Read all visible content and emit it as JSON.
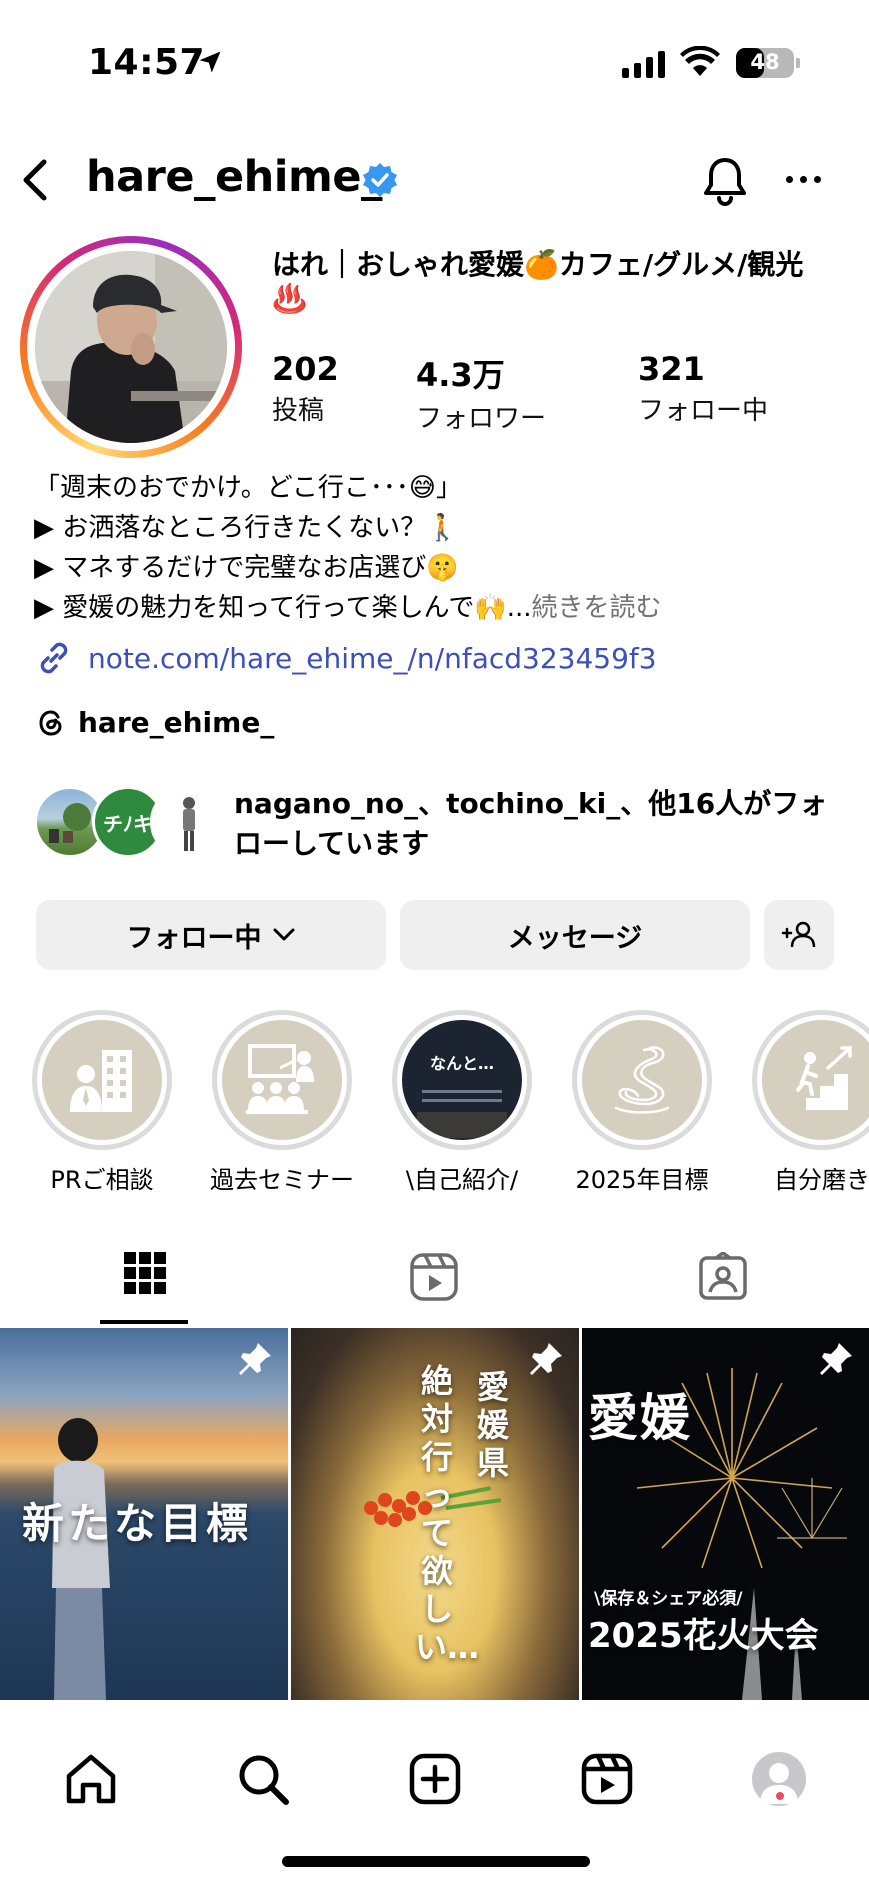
{
  "status_bar": {
    "time": "14:57",
    "battery": "48",
    "battery_level": 0.48
  },
  "header": {
    "username": "hare_ehime_"
  },
  "profile": {
    "display_name": "はれ｜おしゃれ愛媛🍊カフェ/グルメ/観光♨️",
    "stats": [
      {
        "value": "202",
        "label": "投稿"
      },
      {
        "value": "4.3万",
        "label": "フォロワー"
      },
      {
        "value": "321",
        "label": "フォロー中"
      }
    ],
    "bio": {
      "line1": "「週末のおでかけ。どこ行こ･･･😅」",
      "line2": "▶ お洒落なところ行きたくない？🚶",
      "line3": "▶ マネするだけで完璧なお店選び🤫",
      "line4": "▶ 愛媛の魅力を知って行って楽しんで🙌...",
      "more": "続きを読む"
    },
    "link": "note.com/hare_ehime_/n/nfacd323459f3",
    "threads": "hare_ehime_",
    "followed_by": {
      "names": "nagano_no_、tochino_ki_、",
      "rest": "他16人がフォローしています",
      "avatar2_text": "チﾉキ"
    }
  },
  "buttons": {
    "following": "フォロー中",
    "message": "メッセージ"
  },
  "highlights": [
    {
      "label": "PRご相談",
      "icon": "office-building-icon"
    },
    {
      "label": "過去セミナー",
      "icon": "seminar-icon"
    },
    {
      "label": "\\自己紹介/",
      "icon": "photo-thumbnail",
      "text": "なんと…"
    },
    {
      "label": "2025年目標",
      "icon": "snake-icon"
    },
    {
      "label": "自分磨き",
      "icon": "stairs-climb-icon"
    }
  ],
  "tabs": [
    "grid-icon",
    "reels-icon",
    "tagged-icon"
  ],
  "posts": [
    {
      "overlay": "新たな目標"
    },
    {
      "overlay_top": "愛媛県",
      "overlay_main": "絶対行って欲しい…"
    },
    {
      "overlay_top": "愛媛",
      "overlay_sub": "\\保存＆シェア必須/",
      "overlay_main": "2025花火大会"
    }
  ],
  "colors": {
    "link": "#3d4fb8",
    "verified": "#3897f0",
    "button_bg": "#efefef",
    "highlight_bg": "#d5cfbf",
    "notification": "#ed4956"
  }
}
